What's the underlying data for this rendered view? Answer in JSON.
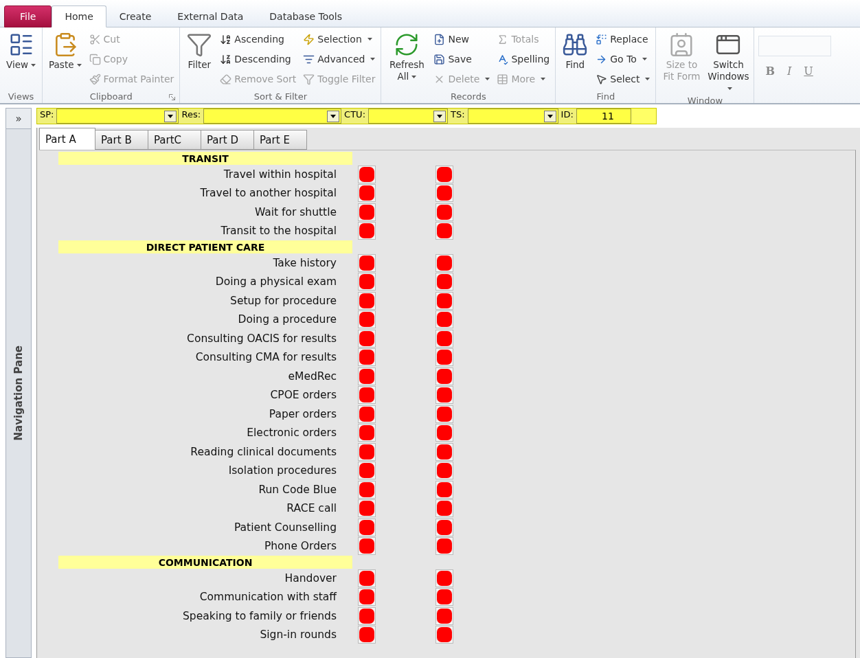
{
  "ribbon": {
    "tabs": [
      {
        "label": "File",
        "kind": "file",
        "selected": false
      },
      {
        "label": "Home",
        "kind": "tab",
        "selected": true
      },
      {
        "label": "Create",
        "kind": "tab",
        "selected": false
      },
      {
        "label": "External Data",
        "kind": "tab",
        "selected": false
      },
      {
        "label": "Database Tools",
        "kind": "tab",
        "selected": false
      }
    ],
    "groups": [
      {
        "label": "Views",
        "launcher": false,
        "columns": [
          {
            "kind": "large",
            "items": [
              {
                "label": "View",
                "disabled": false,
                "dropdown": true
              }
            ]
          }
        ]
      },
      {
        "label": "Clipboard",
        "launcher": true,
        "columns": [
          {
            "kind": "large",
            "items": [
              {
                "label": "Paste",
                "disabled": false,
                "dropdown": true
              }
            ]
          },
          {
            "kind": "small",
            "items": [
              {
                "label": "Cut",
                "disabled": true,
                "dropdown": false
              },
              {
                "label": "Copy",
                "disabled": true,
                "dropdown": false
              },
              {
                "label": "Format Painter",
                "disabled": true,
                "dropdown": false
              }
            ]
          }
        ]
      },
      {
        "label": "Sort & Filter",
        "launcher": false,
        "columns": [
          {
            "kind": "large",
            "items": [
              {
                "label": "Filter",
                "disabled": false,
                "dropdown": false
              }
            ]
          },
          {
            "kind": "small",
            "items": [
              {
                "label": "Ascending",
                "disabled": false,
                "dropdown": false
              },
              {
                "label": "Descending",
                "disabled": false,
                "dropdown": false
              },
              {
                "label": "Remove Sort",
                "disabled": true,
                "dropdown": false
              }
            ]
          },
          {
            "kind": "small",
            "items": [
              {
                "label": "Selection",
                "disabled": false,
                "dropdown": true
              },
              {
                "label": "Advanced",
                "disabled": false,
                "dropdown": true
              },
              {
                "label": "Toggle Filter",
                "disabled": true,
                "dropdown": false
              }
            ]
          }
        ]
      },
      {
        "label": "Records",
        "launcher": false,
        "columns": [
          {
            "kind": "large",
            "items": [
              {
                "label": "Refresh All",
                "disabled": false,
                "dropdown": true
              }
            ]
          },
          {
            "kind": "small",
            "items": [
              {
                "label": "New",
                "disabled": false,
                "dropdown": false
              },
              {
                "label": "Save",
                "disabled": false,
                "dropdown": false
              },
              {
                "label": "Delete",
                "disabled": true,
                "dropdown": true
              }
            ]
          },
          {
            "kind": "small",
            "items": [
              {
                "label": "Totals",
                "disabled": true,
                "dropdown": false
              },
              {
                "label": "Spelling",
                "disabled": false,
                "dropdown": false
              },
              {
                "label": "More",
                "disabled": true,
                "dropdown": true
              }
            ]
          }
        ]
      },
      {
        "label": "Find",
        "launcher": false,
        "columns": [
          {
            "kind": "large",
            "items": [
              {
                "label": "Find",
                "disabled": false,
                "dropdown": false
              }
            ]
          },
          {
            "kind": "small",
            "items": [
              {
                "label": "Replace",
                "disabled": false,
                "dropdown": false
              },
              {
                "label": "Go To",
                "disabled": false,
                "dropdown": true
              },
              {
                "label": "Select",
                "disabled": false,
                "dropdown": true
              }
            ]
          }
        ]
      },
      {
        "label": "Window",
        "launcher": false,
        "columns": [
          {
            "kind": "large",
            "items": [
              {
                "label": "Size to Fit Form",
                "disabled": true,
                "dropdown": false
              }
            ]
          },
          {
            "kind": "large",
            "items": [
              {
                "label": "Switch Windows",
                "disabled": false,
                "dropdown": true
              }
            ]
          }
        ]
      }
    ],
    "format_buttons": [
      {
        "label": "B",
        "disabled": true
      },
      {
        "label": "I",
        "disabled": true
      },
      {
        "label": "U",
        "disabled": true
      }
    ]
  },
  "navigation_pane": {
    "toggle": "»",
    "title": "Navigation Pane"
  },
  "filter_bar": [
    {
      "label": "SP:",
      "kind": "combo"
    },
    {
      "label": "Res:",
      "kind": "combo"
    },
    {
      "label": "CTU:",
      "kind": "combo"
    },
    {
      "label": "TS:",
      "kind": "combo"
    },
    {
      "label": "ID:",
      "kind": "number",
      "value": "11"
    }
  ],
  "form_tabs": [
    {
      "label": "Part A",
      "selected": true
    },
    {
      "label": "Part B",
      "selected": false
    },
    {
      "label": "PartC",
      "selected": false
    },
    {
      "label": "Part D",
      "selected": false
    },
    {
      "label": "Part E",
      "selected": false
    }
  ],
  "sections": [
    {
      "title": "TRANSIT",
      "items": [
        "Travel within hospital",
        "Travel to another hospital",
        "Wait for shuttle",
        "Transit to the hospital"
      ]
    },
    {
      "title": "DIRECT PATIENT CARE",
      "items": [
        "Take history",
        "Doing a physical exam",
        "Setup for procedure",
        "Doing a procedure",
        "Consulting OACIS for results",
        "Consulting CMA for results",
        "eMedRec",
        "CPOE orders",
        "Paper orders",
        "Electronic orders",
        "Reading clinical documents",
        "Isolation procedures",
        "Run Code Blue",
        "RACE call",
        "Patient Counselling",
        "Phone Orders"
      ]
    },
    {
      "title": "COMMUNICATION",
      "items": [
        "Handover",
        "Communication with staff",
        "Speaking to family or friends",
        "Sign-in rounds"
      ]
    }
  ]
}
